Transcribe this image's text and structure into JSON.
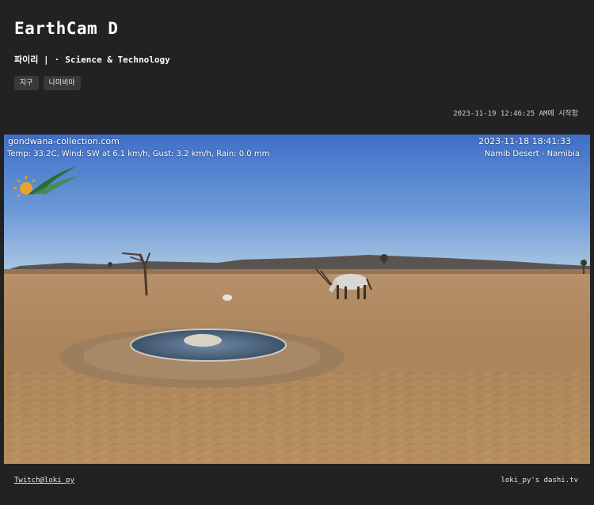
{
  "header": {
    "title": "EarthCam D",
    "author": "파이리",
    "category": "Science & Technology",
    "tags": [
      "지구",
      "나미비아"
    ],
    "started": "2023-11-19 12:46:25 AM에 시작함"
  },
  "stream": {
    "overlay_site": "gondwana-collection.com",
    "overlay_weather": "Temp: 33.2C, Wind: SW at 6.1 km/h, Gust: 3.2 km/h, Rain: 0.0 mm",
    "overlay_datetime": "2023-11-18 18:41:33",
    "overlay_location": "Namib Desert - Namibia"
  },
  "footer": {
    "twitch_link": "Twitch@loki_py",
    "credit": "loki_py's dashi.tv"
  },
  "colors": {
    "page_bg": "#222222",
    "tag_bg": "#393939",
    "sky_top": "#3f6fc8",
    "sky_horizon": "#a9c6e2",
    "sand": "#b58e62"
  }
}
